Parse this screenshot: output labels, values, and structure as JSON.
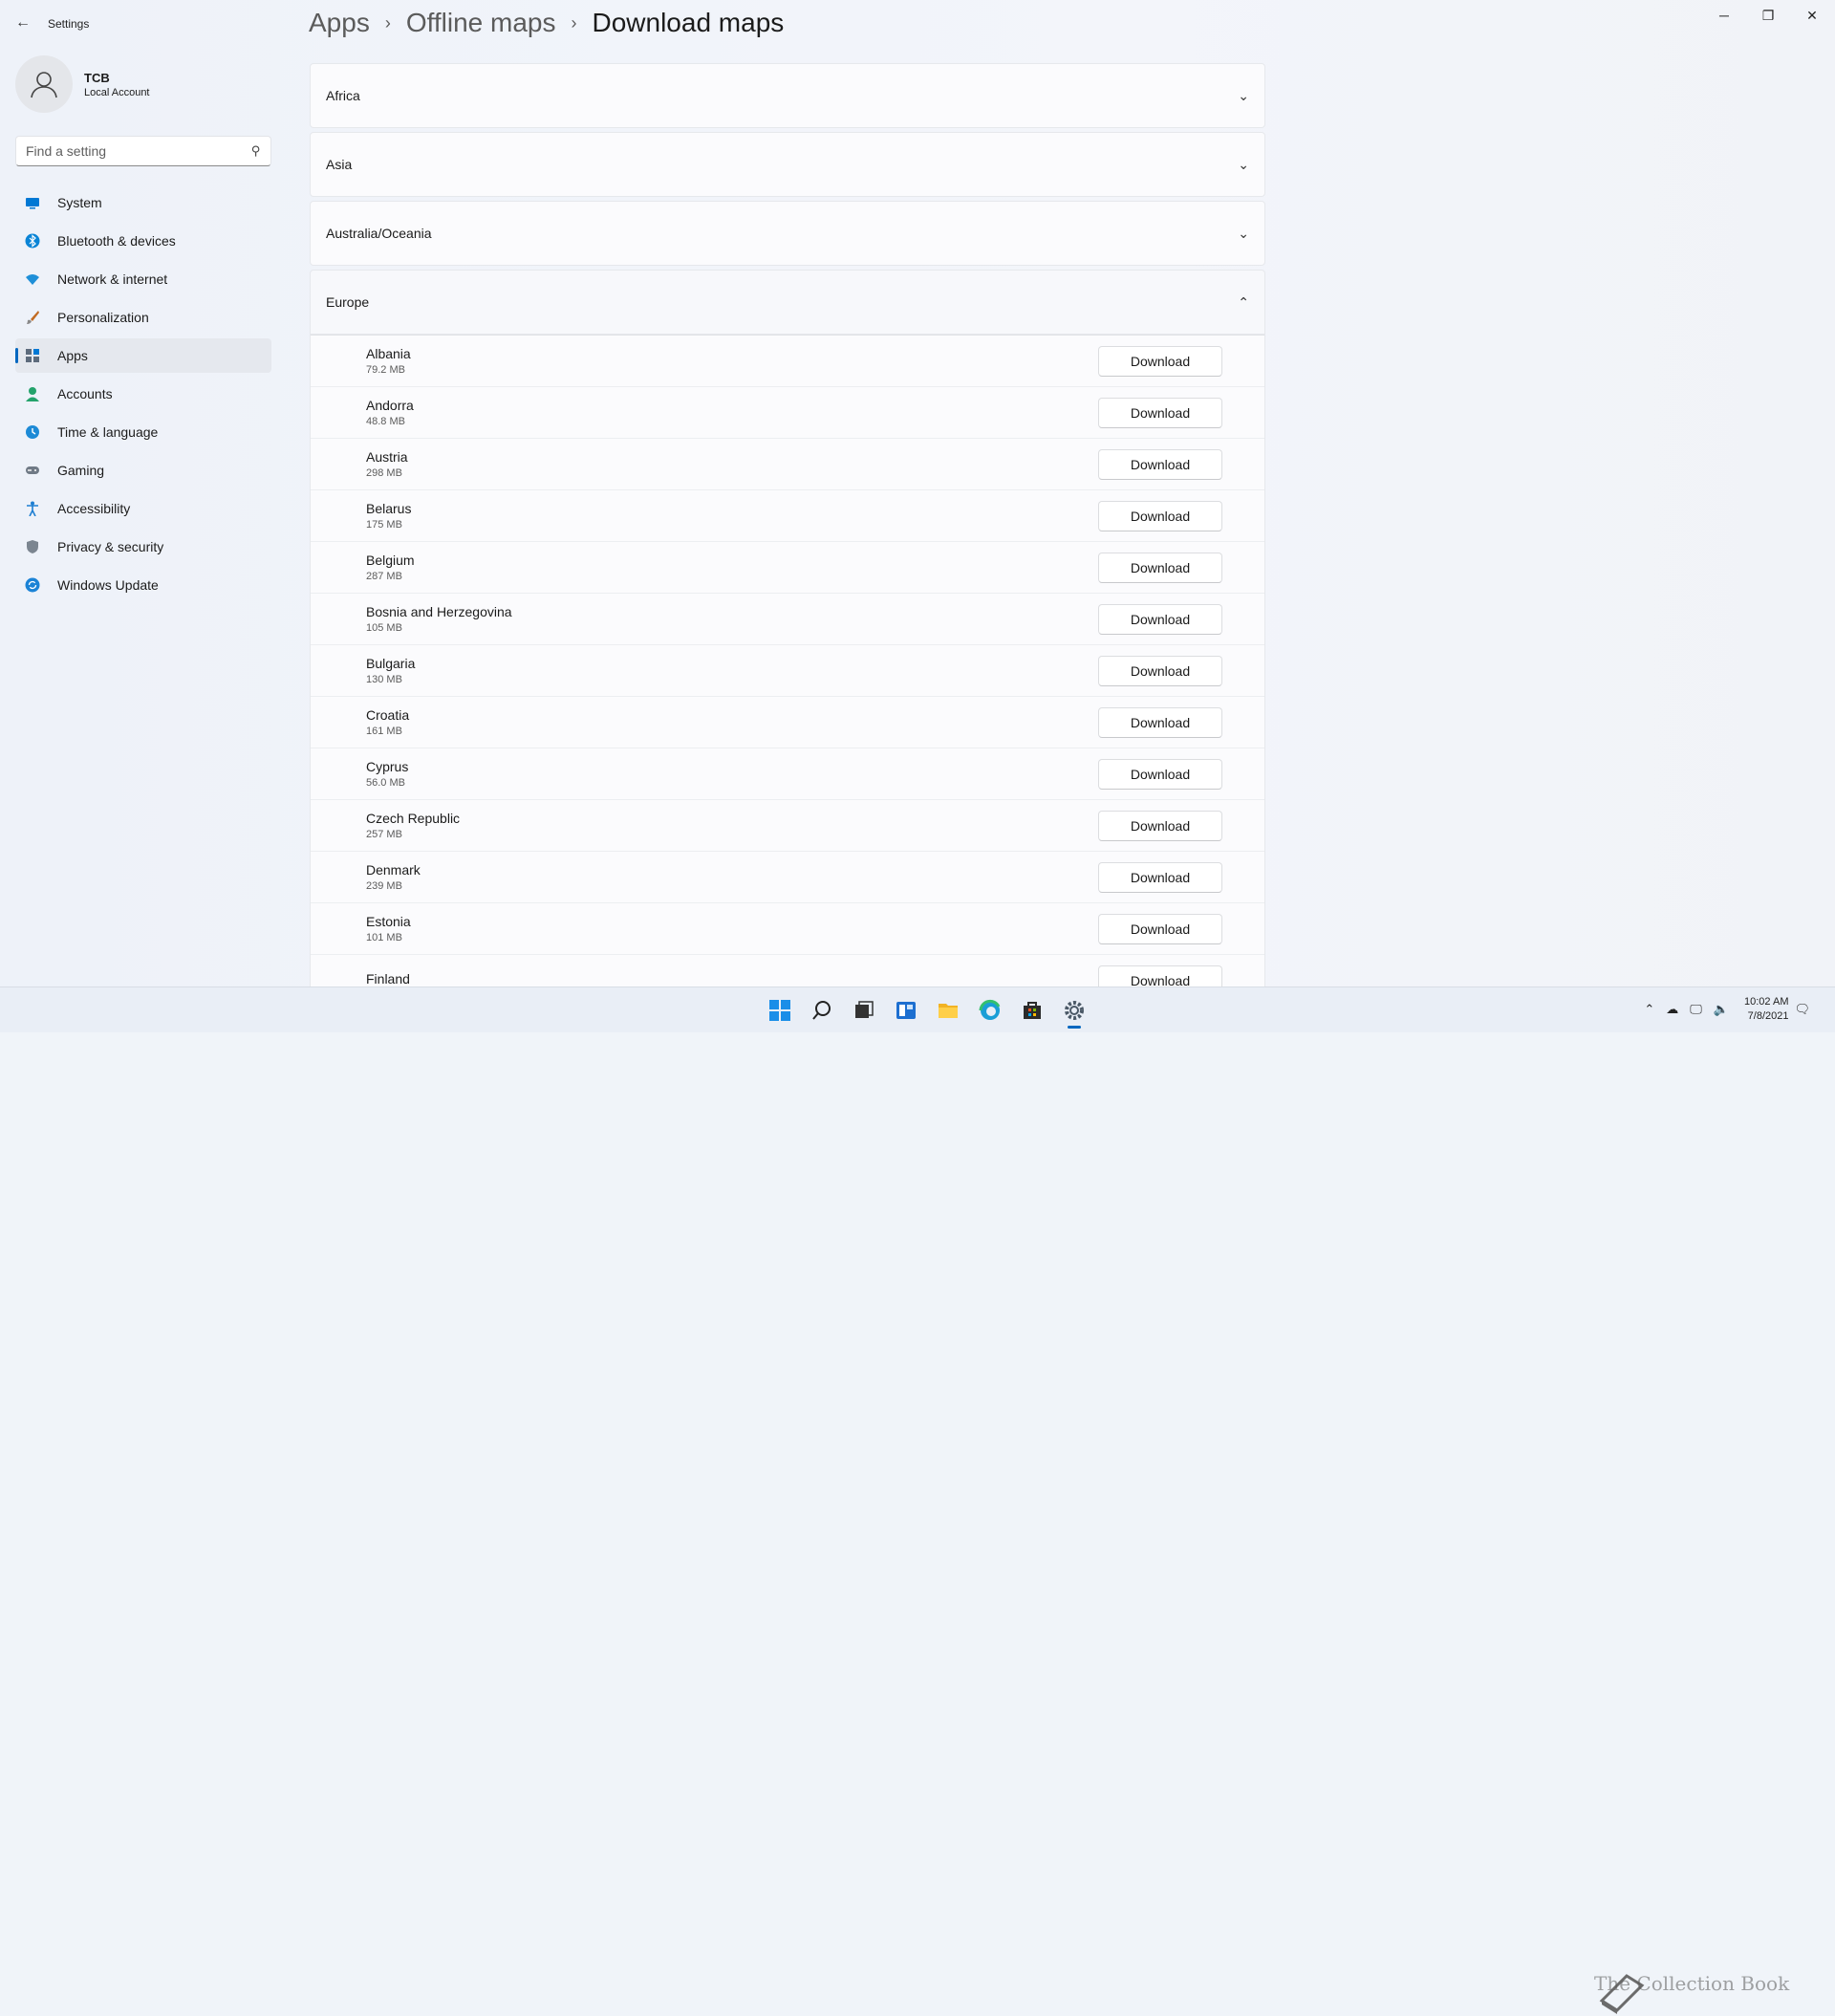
{
  "window": {
    "title": "Settings",
    "controls": {
      "minimize": "─",
      "restore": "❐",
      "close": "✕"
    }
  },
  "profile": {
    "name": "TCB",
    "account_type": "Local Account"
  },
  "search": {
    "placeholder": "Find a setting"
  },
  "sidebar": {
    "items": [
      {
        "label": "System",
        "icon": "system-icon",
        "color": "#0078d4"
      },
      {
        "label": "Bluetooth & devices",
        "icon": "bluetooth-icon",
        "color": "#0a84d6"
      },
      {
        "label": "Network & internet",
        "icon": "wifi-icon",
        "color": "#1e8fd8"
      },
      {
        "label": "Personalization",
        "icon": "brush-icon",
        "color": "#c26b22"
      },
      {
        "label": "Apps",
        "icon": "apps-icon",
        "color": "#5d6b7c",
        "active": true
      },
      {
        "label": "Accounts",
        "icon": "person-icon",
        "color": "#23a26b"
      },
      {
        "label": "Time & language",
        "icon": "globe-clock-icon",
        "color": "#1d8ad6"
      },
      {
        "label": "Gaming",
        "icon": "gamepad-icon",
        "color": "#707a86"
      },
      {
        "label": "Accessibility",
        "icon": "accessibility-icon",
        "color": "#1f7fd2"
      },
      {
        "label": "Privacy & security",
        "icon": "shield-icon",
        "color": "#7b8590"
      },
      {
        "label": "Windows Update",
        "icon": "update-icon",
        "color": "#1b83d6"
      }
    ]
  },
  "breadcrumb": {
    "level1": "Apps",
    "level2": "Offline maps",
    "current": "Download maps",
    "separator": "›"
  },
  "regions": {
    "africa": "Africa",
    "asia": "Asia",
    "australia": "Australia/Oceania",
    "europe": "Europe"
  },
  "download_label": "Download",
  "countries": [
    {
      "name": "Albania",
      "size": "79.2 MB"
    },
    {
      "name": "Andorra",
      "size": "48.8 MB"
    },
    {
      "name": "Austria",
      "size": "298 MB"
    },
    {
      "name": "Belarus",
      "size": "175 MB"
    },
    {
      "name": "Belgium",
      "size": "287 MB"
    },
    {
      "name": "Bosnia and Herzegovina",
      "size": "105 MB"
    },
    {
      "name": "Bulgaria",
      "size": "130 MB"
    },
    {
      "name": "Croatia",
      "size": "161 MB"
    },
    {
      "name": "Cyprus",
      "size": "56.0 MB"
    },
    {
      "name": "Czech Republic",
      "size": "257 MB"
    },
    {
      "name": "Denmark",
      "size": "239 MB"
    },
    {
      "name": "Estonia",
      "size": "101 MB"
    },
    {
      "name": "Finland",
      "size": ""
    }
  ],
  "taskbar": {
    "icons": [
      "start-icon",
      "search-icon",
      "task-view-icon",
      "widgets-icon",
      "file-explorer-icon",
      "edge-icon",
      "store-icon",
      "settings-icon"
    ],
    "time": "10:02 AM",
    "date": "7/8/2021",
    "watermark": "The Collection Book"
  }
}
